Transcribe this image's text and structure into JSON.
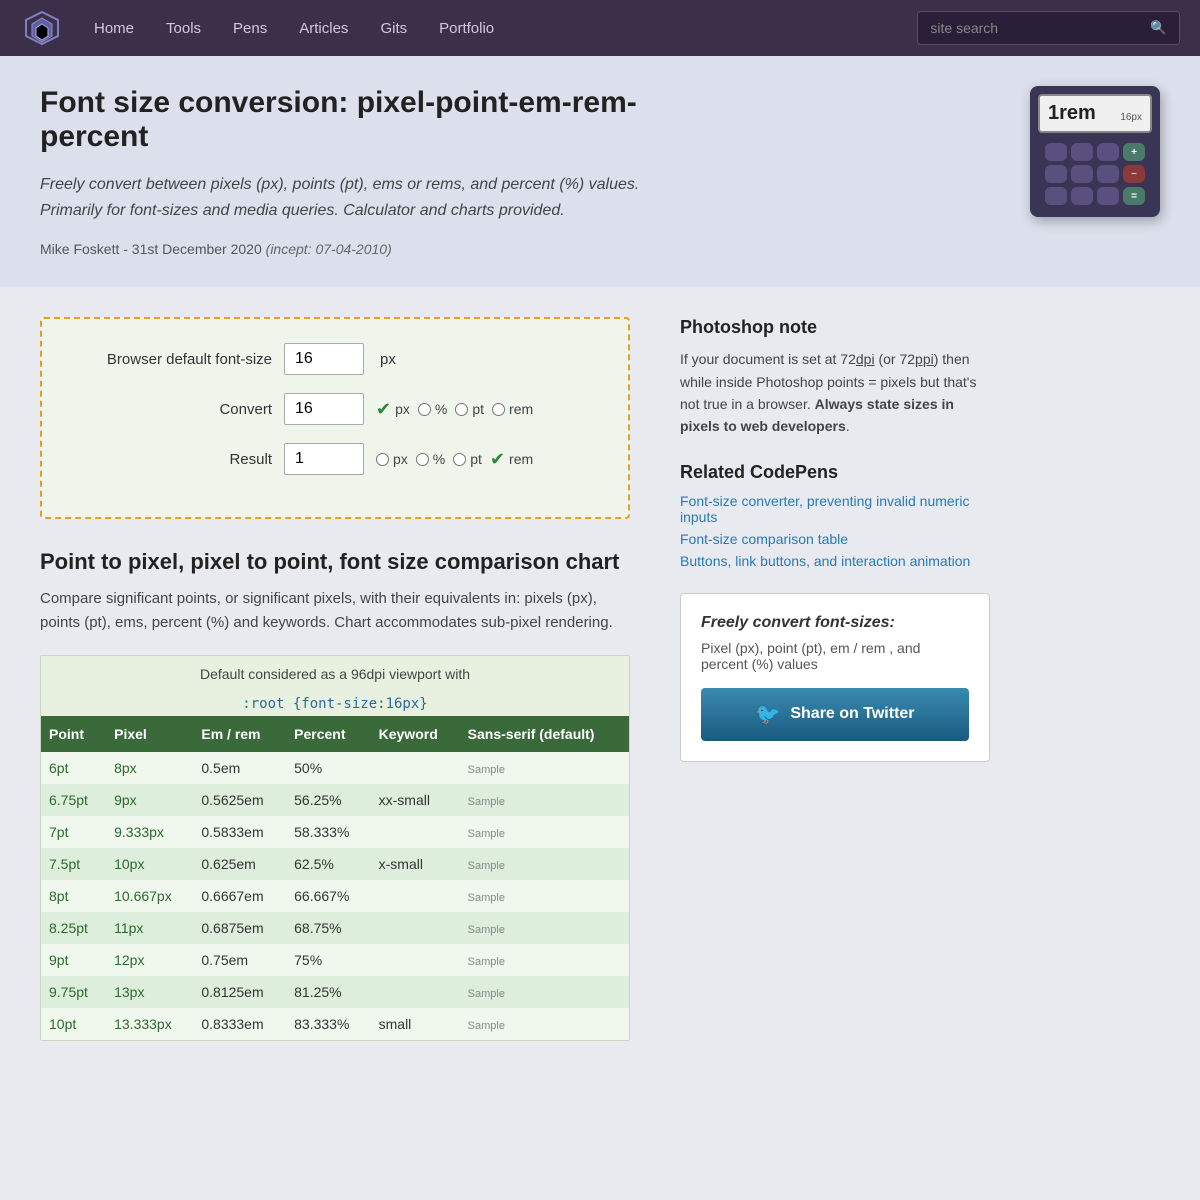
{
  "nav": {
    "links": [
      "Home",
      "Tools",
      "Pens",
      "Articles",
      "Gits",
      "Portfolio"
    ],
    "search_placeholder": "site search"
  },
  "hero": {
    "title": "Font size conversion: pixel-point-em-rem-percent",
    "description": "Freely convert between pixels (px), points (pt), ems or rems, and percent (%) values. Primarily for font-sizes and media queries. Calculator and charts provided.",
    "author": "Mike Foskett - 31st December 2020",
    "incept": "(incept: 07-04-2010)"
  },
  "calc": {
    "display_val": "1rem",
    "display_unit": "16px"
  },
  "converter": {
    "label_default": "Browser default font-size",
    "default_val": "16",
    "default_unit": "px",
    "convert_label": "Convert",
    "convert_val": "16",
    "result_label": "Result",
    "result_val": "1",
    "units": {
      "px": "px",
      "percent": "%",
      "pt": "pt",
      "rem": "rem"
    }
  },
  "chart": {
    "title": "Point to pixel, pixel to point, font size comparison chart",
    "description": "Compare significant points, or significant pixels, with their equivalents in: pixels (px), points (pt), ems, percent (%) and keywords. Chart accommodates sub-pixel rendering.",
    "header_note": "Default considered as a 96dpi viewport with",
    "header_code": ":root {font-size:16px}",
    "columns": [
      "Point",
      "Pixel",
      "Em / rem",
      "Percent",
      "Keyword",
      "Sans-serif (default)"
    ],
    "rows": [
      {
        "pt": "6pt",
        "px": "8px",
        "em": "0.5em",
        "pct": "50%",
        "kw": "",
        "sample": "Sample"
      },
      {
        "pt": "6.75pt",
        "px": "9px",
        "em": "0.5625em",
        "pct": "56.25%",
        "kw": "xx-small",
        "sample": "Sample"
      },
      {
        "pt": "7pt",
        "px": "9.333px",
        "em": "0.5833em",
        "pct": "58.333%",
        "kw": "",
        "sample": "Sample"
      },
      {
        "pt": "7.5pt",
        "px": "10px",
        "em": "0.625em",
        "pct": "62.5%",
        "kw": "x-small",
        "sample": "Sample"
      },
      {
        "pt": "8pt",
        "px": "10.667px",
        "em": "0.6667em",
        "pct": "66.667%",
        "kw": "",
        "sample": "Sample"
      },
      {
        "pt": "8.25pt",
        "px": "11px",
        "em": "0.6875em",
        "pct": "68.75%",
        "kw": "",
        "sample": "Sample"
      },
      {
        "pt": "9pt",
        "px": "12px",
        "em": "0.75em",
        "pct": "75%",
        "kw": "",
        "sample": "Sample"
      },
      {
        "pt": "9.75pt",
        "px": "13px",
        "em": "0.8125em",
        "pct": "81.25%",
        "kw": "",
        "sample": "Sample"
      },
      {
        "pt": "10pt",
        "px": "13.333px",
        "em": "0.8333em",
        "pct": "83.333%",
        "kw": "small",
        "sample": "Sample"
      }
    ]
  },
  "sidebar": {
    "photoshop_title": "Photoshop note",
    "photoshop_text1": "If your document is set at 72",
    "photoshop_dpi1": "dpi",
    "photoshop_text2": " (or 72",
    "photoshop_ppi": "ppi",
    "photoshop_text3": ") then while inside Photoshop points = pixels but that's not true in a browser.",
    "photoshop_bold": "Always state sizes in pixels to web developers",
    "photoshop_end": ".",
    "related_title": "Related CodePens",
    "related_links": [
      "Font-size converter, preventing invalid numeric inputs",
      "Font-size comparison table",
      "Buttons, link buttons, and interaction animation"
    ],
    "twitter_card_title": "Freely convert font-sizes:",
    "twitter_card_desc": "Pixel (px), point (pt), em / rem , and percent (%) values",
    "twitter_btn": "Share on Twitter"
  }
}
